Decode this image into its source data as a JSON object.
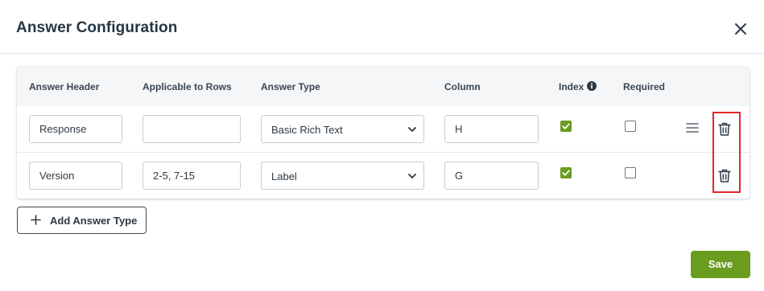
{
  "dialog": {
    "title": "Answer Configuration",
    "close_icon": "close-icon"
  },
  "table": {
    "headers": {
      "answer_header": "Answer Header",
      "applicable_rows": "Applicable to Rows",
      "answer_type": "Answer Type",
      "column": "Column",
      "index": "Index",
      "required": "Required"
    },
    "rows": [
      {
        "answer_header": "Response",
        "applicable_rows": "",
        "answer_type": "Basic Rich Text",
        "column": "H",
        "index": true,
        "required": false,
        "has_drag_handle": true
      },
      {
        "answer_header": "Version",
        "applicable_rows": "2-5, 7-15",
        "answer_type": "Label",
        "column": "G",
        "index": true,
        "required": false,
        "has_drag_handle": false
      }
    ]
  },
  "actions": {
    "add_answer_type": "Add Answer Type",
    "save": "Save"
  },
  "colors": {
    "accent_green": "#6a9c1f",
    "highlight_red": "#e0252b",
    "title_text": "#263645"
  }
}
